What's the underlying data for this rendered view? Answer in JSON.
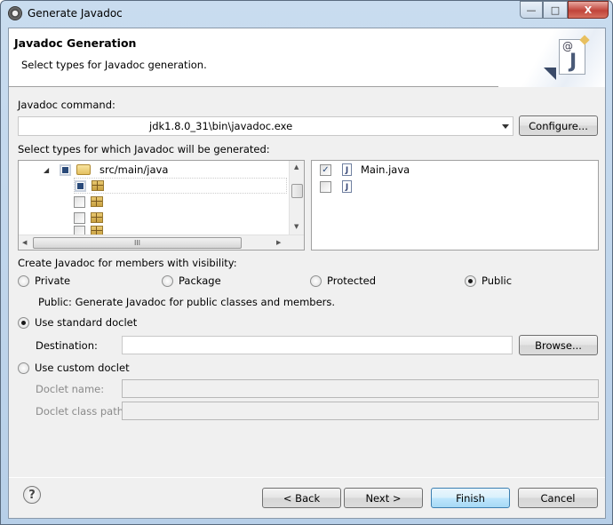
{
  "window": {
    "title": "Generate Javadoc",
    "minimize_label": "—",
    "maximize_label": "□",
    "close_label": "X"
  },
  "header": {
    "title": "Javadoc Generation",
    "subtitle": "Select types for Javadoc generation.",
    "icon_at": "@",
    "icon_j": "J"
  },
  "javadoc_command": {
    "label": "Javadoc command:",
    "value": "jdk1.8.0_31\\bin\\javadoc.exe",
    "configure_label": "Configure..."
  },
  "types": {
    "label": "Select types for which Javadoc will be generated:",
    "tree": {
      "root": {
        "label": "src/main/java",
        "expanded": true,
        "state": "partial"
      },
      "packages": [
        {
          "label": "",
          "state": "partial",
          "selected": true
        },
        {
          "label": "",
          "state": "unchecked"
        },
        {
          "label": "",
          "state": "unchecked"
        },
        {
          "label": "",
          "state": "unchecked"
        }
      ],
      "hscroll_grip": "III"
    },
    "files": [
      {
        "label": "Main.java",
        "checked": true,
        "icon": "J"
      },
      {
        "label": "",
        "checked": false,
        "icon": "J"
      }
    ]
  },
  "visibility": {
    "label": "Create Javadoc for members with visibility:",
    "options": [
      {
        "label": "Private",
        "selected": false
      },
      {
        "label": "Package",
        "selected": false
      },
      {
        "label": "Protected",
        "selected": false
      },
      {
        "label": "Public",
        "selected": true
      }
    ],
    "description": "Public: Generate Javadoc for public classes and members."
  },
  "doclet": {
    "standard_label": "Use standard doclet",
    "standard_selected": true,
    "destination_label": "Destination:",
    "destination_value": "",
    "browse_label": "Browse...",
    "custom_label": "Use custom doclet",
    "custom_selected": false,
    "doclet_name_label": "Doclet name:",
    "doclet_name_value": "",
    "doclet_classpath_label": "Doclet class path:",
    "doclet_classpath_value": ""
  },
  "footer": {
    "help_label": "?",
    "back_label": "< Back",
    "next_label": "Next >",
    "finish_label": "Finish",
    "cancel_label": "Cancel"
  }
}
